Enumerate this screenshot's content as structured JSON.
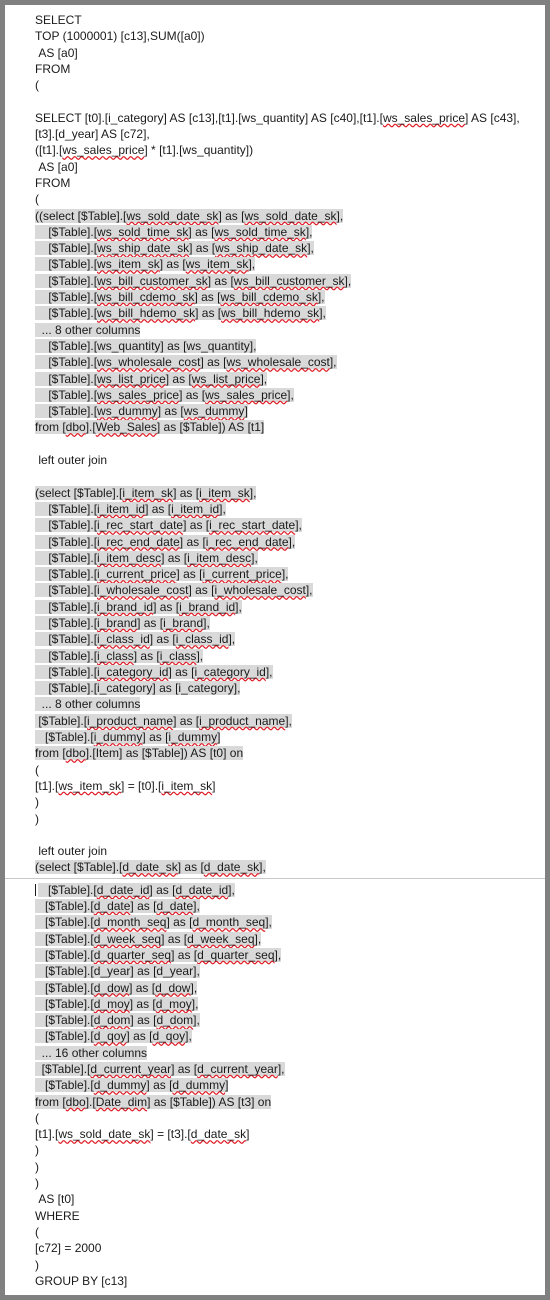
{
  "window": {
    "title": "SQL Query Text View",
    "border_color": "#808080",
    "background_color": "#ffffff",
    "selection_highlight_color": "#d9d9d9",
    "spellcheck_underline_color": "#e01b24",
    "text_color": "#1a1a1a",
    "divider_color": "#c8c8c8"
  },
  "code": {
    "lines": [
      {
        "id": "l1",
        "text": "SELECT"
      },
      {
        "id": "l2",
        "text": "TOP (1000001) [c13],SUM([a0])"
      },
      {
        "id": "l3",
        "text": " AS [a0]"
      },
      {
        "id": "l4",
        "text": "FROM"
      },
      {
        "id": "l5",
        "text": "("
      },
      {
        "id": "l6",
        "text": ""
      },
      {
        "id": "l7",
        "text": "SELECT [t0].[i_category] AS [c13],[t1].[ws_quantity] AS [c40],[t1].[ws_sales_price] AS [c43],[t3].[d_year] AS [c72],"
      },
      {
        "id": "l8",
        "text": "([t1].[ws_sales_price] * [t1].[ws_quantity])"
      },
      {
        "id": "l9",
        "text": " AS [a0]"
      },
      {
        "id": "l10",
        "text": "FROM"
      },
      {
        "id": "l11",
        "text": "("
      },
      {
        "id": "l12",
        "text": "((select [$Table].[ws_sold_date_sk] as [ws_sold_date_sk],"
      },
      {
        "id": "l13",
        "text": "    [$Table].[ws_sold_time_sk] as [ws_sold_time_sk],"
      },
      {
        "id": "l14",
        "text": "    [$Table].[ws_ship_date_sk] as [ws_ship_date_sk],"
      },
      {
        "id": "l15",
        "text": "    [$Table].[ws_item_sk] as [ws_item_sk],"
      },
      {
        "id": "l16",
        "text": "    [$Table].[ws_bill_customer_sk] as [ws_bill_customer_sk],"
      },
      {
        "id": "l17",
        "text": "    [$Table].[ws_bill_cdemo_sk] as [ws_bill_cdemo_sk],"
      },
      {
        "id": "l18",
        "text": "    [$Table].[ws_bill_hdemo_sk] as [ws_bill_hdemo_sk],"
      },
      {
        "id": "l19",
        "text": "  ... 8 other columns"
      },
      {
        "id": "l20",
        "text": "    [$Table].[ws_quantity] as [ws_quantity],"
      },
      {
        "id": "l21",
        "text": "    [$Table].[ws_wholesale_cost] as [ws_wholesale_cost],"
      },
      {
        "id": "l22",
        "text": "    [$Table].[ws_list_price] as [ws_list_price],"
      },
      {
        "id": "l23",
        "text": "    [$Table].[ws_sales_price] as [ws_sales_price],"
      },
      {
        "id": "l24",
        "text": "    [$Table].[ws_dummy] as [ws_dummy]"
      },
      {
        "id": "l25",
        "text": "from [dbo].[Web_Sales] as [$Table]) AS [t1]"
      },
      {
        "id": "l26",
        "text": ""
      },
      {
        "id": "l27",
        "text": " left outer join"
      },
      {
        "id": "l28",
        "text": ""
      },
      {
        "id": "l29",
        "text": "(select [$Table].[i_item_sk] as [i_item_sk],"
      },
      {
        "id": "l30",
        "text": "    [$Table].[i_item_id] as [i_item_id],"
      },
      {
        "id": "l31",
        "text": "    [$Table].[i_rec_start_date] as [i_rec_start_date],"
      },
      {
        "id": "l32",
        "text": "    [$Table].[i_rec_end_date] as [i_rec_end_date],"
      },
      {
        "id": "l33",
        "text": "    [$Table].[i_item_desc] as [i_item_desc],"
      },
      {
        "id": "l34",
        "text": "    [$Table].[i_current_price] as [i_current_price],"
      },
      {
        "id": "l35",
        "text": "    [$Table].[i_wholesale_cost] as [i_wholesale_cost],"
      },
      {
        "id": "l36",
        "text": "    [$Table].[i_brand_id] as [i_brand_id],"
      },
      {
        "id": "l37",
        "text": "    [$Table].[i_brand] as [i_brand],"
      },
      {
        "id": "l38",
        "text": "    [$Table].[i_class_id] as [i_class_id],"
      },
      {
        "id": "l39",
        "text": "    [$Table].[i_class] as [i_class],"
      },
      {
        "id": "l40",
        "text": "    [$Table].[i_category_id] as [i_category_id],"
      },
      {
        "id": "l41",
        "text": "    [$Table].[i_category] as [i_category],"
      },
      {
        "id": "l42",
        "text": "  ... 8 other columns"
      },
      {
        "id": "l43",
        "text": " [$Table].[i_product_name] as [i_product_name],"
      },
      {
        "id": "l44",
        "text": "   [$Table].[i_dummy] as [i_dummy]"
      },
      {
        "id": "l45",
        "text": "from [dbo].[Item] as [$Table]) AS [t0] on"
      },
      {
        "id": "l46",
        "text": "("
      },
      {
        "id": "l47",
        "text": "[t1].[ws_item_sk] = [t0].[i_item_sk]"
      },
      {
        "id": "l48",
        "text": ")"
      },
      {
        "id": "l49",
        "text": ")"
      },
      {
        "id": "l50",
        "text": ""
      },
      {
        "id": "l51",
        "text": " left outer join"
      },
      {
        "id": "l52",
        "text": "(select [$Table].[d_date_sk] as [d_date_sk],"
      },
      {
        "id": "l53",
        "text": "   [$Table].[d_date_id] as [d_date_id],"
      },
      {
        "id": "l54",
        "text": "   [$Table].[d_date] as [d_date],"
      },
      {
        "id": "l55",
        "text": "   [$Table].[d_month_seq] as [d_month_seq],"
      },
      {
        "id": "l56",
        "text": "   [$Table].[d_week_seq] as [d_week_seq],"
      },
      {
        "id": "l57",
        "text": "   [$Table].[d_quarter_seq] as [d_quarter_seq],"
      },
      {
        "id": "l58",
        "text": "   [$Table].[d_year] as [d_year],"
      },
      {
        "id": "l59",
        "text": "   [$Table].[d_dow] as [d_dow],"
      },
      {
        "id": "l60",
        "text": "   [$Table].[d_moy] as [d_moy],"
      },
      {
        "id": "l61",
        "text": "   [$Table].[d_dom] as [d_dom],"
      },
      {
        "id": "l62",
        "text": "   [$Table].[d_qoy] as [d_qoy],"
      },
      {
        "id": "l63",
        "text": "  ... 16 other columns"
      },
      {
        "id": "l64",
        "text": "  [$Table].[d_current_year] as [d_current_year],"
      },
      {
        "id": "l65",
        "text": "   [$Table].[d_dummy] as [d_dummy]"
      },
      {
        "id": "l66",
        "text": "from [dbo].[Date_dim] as [$Table]) AS [t3] on"
      },
      {
        "id": "l67",
        "text": "("
      },
      {
        "id": "l68",
        "text": "[t1].[ws_sold_date_sk] = [t3].[d_date_sk]"
      },
      {
        "id": "l69",
        "text": ")"
      },
      {
        "id": "l70",
        "text": ")"
      },
      {
        "id": "l71",
        "text": ")"
      },
      {
        "id": "l72",
        "text": " AS [t0]"
      },
      {
        "id": "l73",
        "text": "WHERE"
      },
      {
        "id": "l74",
        "text": "("
      },
      {
        "id": "l75",
        "text": "[c72] = 2000"
      },
      {
        "id": "l76",
        "text": ")"
      },
      {
        "id": "l77",
        "text": "GROUP BY [c13]"
      }
    ],
    "selected_line_ids": [
      "l12",
      "l13",
      "l14",
      "l15",
      "l16",
      "l17",
      "l18",
      "l19",
      "l20",
      "l21",
      "l22",
      "l23",
      "l24",
      "l25",
      "l29",
      "l30",
      "l31",
      "l32",
      "l33",
      "l34",
      "l35",
      "l36",
      "l37",
      "l38",
      "l39",
      "l40",
      "l41",
      "l42",
      "l43",
      "l44",
      "l45",
      "l52",
      "l53",
      "l54",
      "l55",
      "l56",
      "l57",
      "l58",
      "l59",
      "l60",
      "l61",
      "l62",
      "l63",
      "l64",
      "l65",
      "l66"
    ],
    "divider_after_line_id": "l52",
    "caret_line_id": "l53",
    "spellchecked_tokens": [
      "ws_sold_date_sk",
      "ws_sold_time_sk",
      "ws_ship_date_sk",
      "ws_item_sk",
      "ws_bill_customer_sk",
      "ws_bill_cdemo_sk",
      "ws_bill_hdemo_sk",
      "ws_wholesale_cost",
      "ws_list_price",
      "ws_sales_price",
      "ws_dummy",
      "dbo",
      "Web_Sales",
      "i_item_sk",
      "i_item_id",
      "i_rec_start_date",
      "i_rec_end_date",
      "i_item_desc",
      "i_current_price",
      "i_wholesale_cost",
      "i_brand_id",
      "i_brand",
      "i_class_id",
      "i_class",
      "i_category_id",
      "i_product_name",
      "i_dummy",
      "d_date_sk",
      "d_date_id",
      "d_date",
      "d_month_seq",
      "d_week_seq",
      "d_quarter_seq",
      "d_dow",
      "d_moy",
      "d_dom",
      "d_qoy",
      "d_current_year",
      "d_dummy",
      "Date_dim"
    ]
  }
}
